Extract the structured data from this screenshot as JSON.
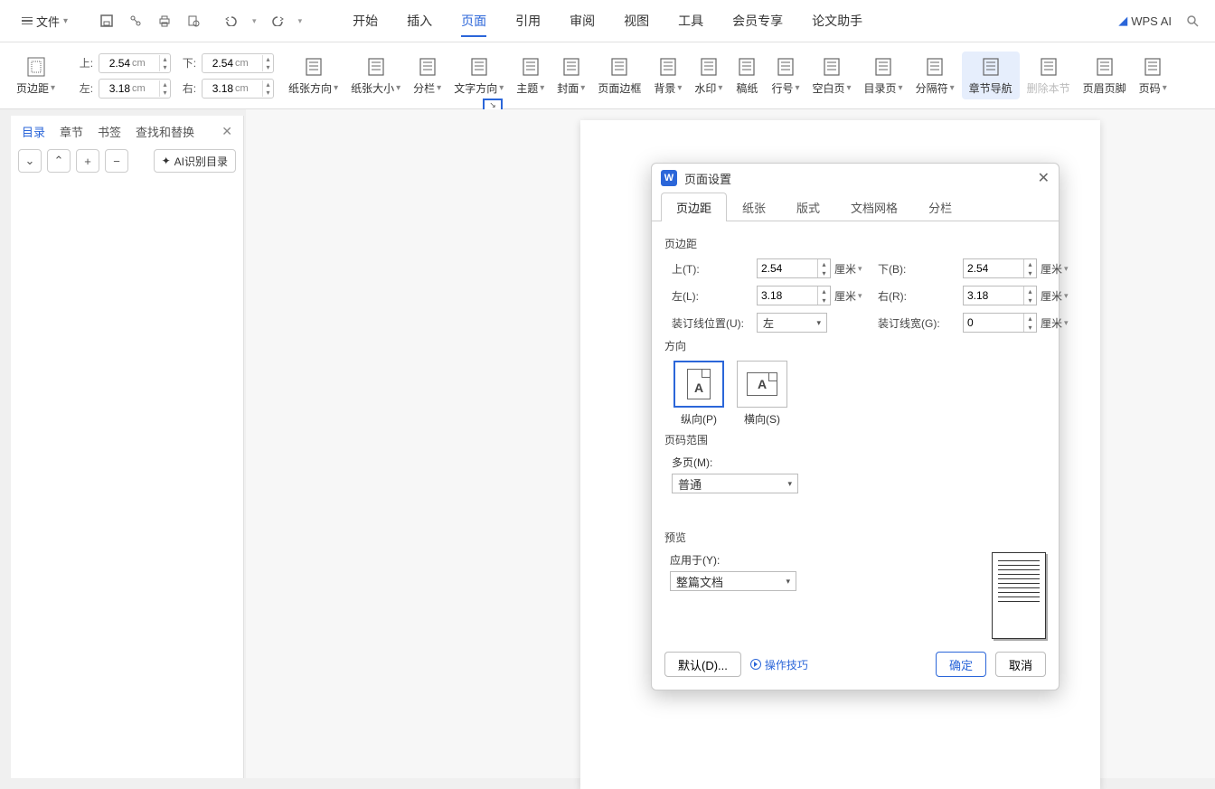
{
  "menubar": {
    "file_label": "文件",
    "tabs": [
      "开始",
      "插入",
      "页面",
      "引用",
      "审阅",
      "视图",
      "工具",
      "会员专享",
      "论文助手"
    ],
    "active_tab_index": 2,
    "wps_ai": "WPS AI"
  },
  "ribbon": {
    "margins": {
      "button_label": "页边距",
      "top_label": "上:",
      "top_value": "2.54",
      "bottom_label": "下:",
      "bottom_value": "2.54",
      "left_label": "左:",
      "left_value": "3.18",
      "right_label": "右:",
      "right_value": "3.18",
      "unit": "cm"
    },
    "items": [
      {
        "label": "纸张方向",
        "caret": true
      },
      {
        "label": "纸张大小",
        "caret": true
      },
      {
        "label": "分栏",
        "caret": true
      },
      {
        "label": "文字方向",
        "caret": true
      },
      {
        "label": "主题",
        "caret": true
      },
      {
        "label": "封面",
        "caret": true
      },
      {
        "label": "页面边框",
        "caret": false
      },
      {
        "label": "背景",
        "caret": true
      },
      {
        "label": "水印",
        "caret": true
      },
      {
        "label": "稿纸",
        "caret": false
      },
      {
        "label": "行号",
        "caret": true
      },
      {
        "label": "空白页",
        "caret": true
      },
      {
        "label": "目录页",
        "caret": true
      },
      {
        "label": "分隔符",
        "caret": true
      },
      {
        "label": "章节导航",
        "caret": false,
        "highlighted": true
      },
      {
        "label": "删除本节",
        "caret": false,
        "disabled": true
      },
      {
        "label": "页眉页脚",
        "caret": false
      },
      {
        "label": "页码",
        "caret": true
      }
    ]
  },
  "sidepanel": {
    "tabs": [
      "目录",
      "章节",
      "书签",
      "查找和替换"
    ],
    "active_index": 0,
    "ai_button": "AI识别目录"
  },
  "dialog": {
    "title": "页面设置",
    "tabs": [
      "页边距",
      "纸张",
      "版式",
      "文档网格",
      "分栏"
    ],
    "active_tab_index": 0,
    "section_margins": "页边距",
    "top_label": "上(T):",
    "top_value": "2.54",
    "bottom_label": "下(B):",
    "bottom_value": "2.54",
    "left_label": "左(L):",
    "left_value": "3.18",
    "right_label": "右(R):",
    "right_value": "3.18",
    "gutter_pos_label": "装订线位置(U):",
    "gutter_pos_value": "左",
    "gutter_width_label": "装订线宽(G):",
    "gutter_width_value": "0",
    "unit": "厘米",
    "section_orientation": "方向",
    "portrait_label": "纵向(P)",
    "landscape_label": "横向(S)",
    "section_range": "页码范围",
    "multipage_label": "多页(M):",
    "multipage_value": "普通",
    "section_preview": "预览",
    "applyto_label": "应用于(Y):",
    "applyto_value": "整篇文档",
    "default_btn": "默认(D)...",
    "tips_link": "操作技巧",
    "ok_btn": "确定",
    "cancel_btn": "取消"
  }
}
